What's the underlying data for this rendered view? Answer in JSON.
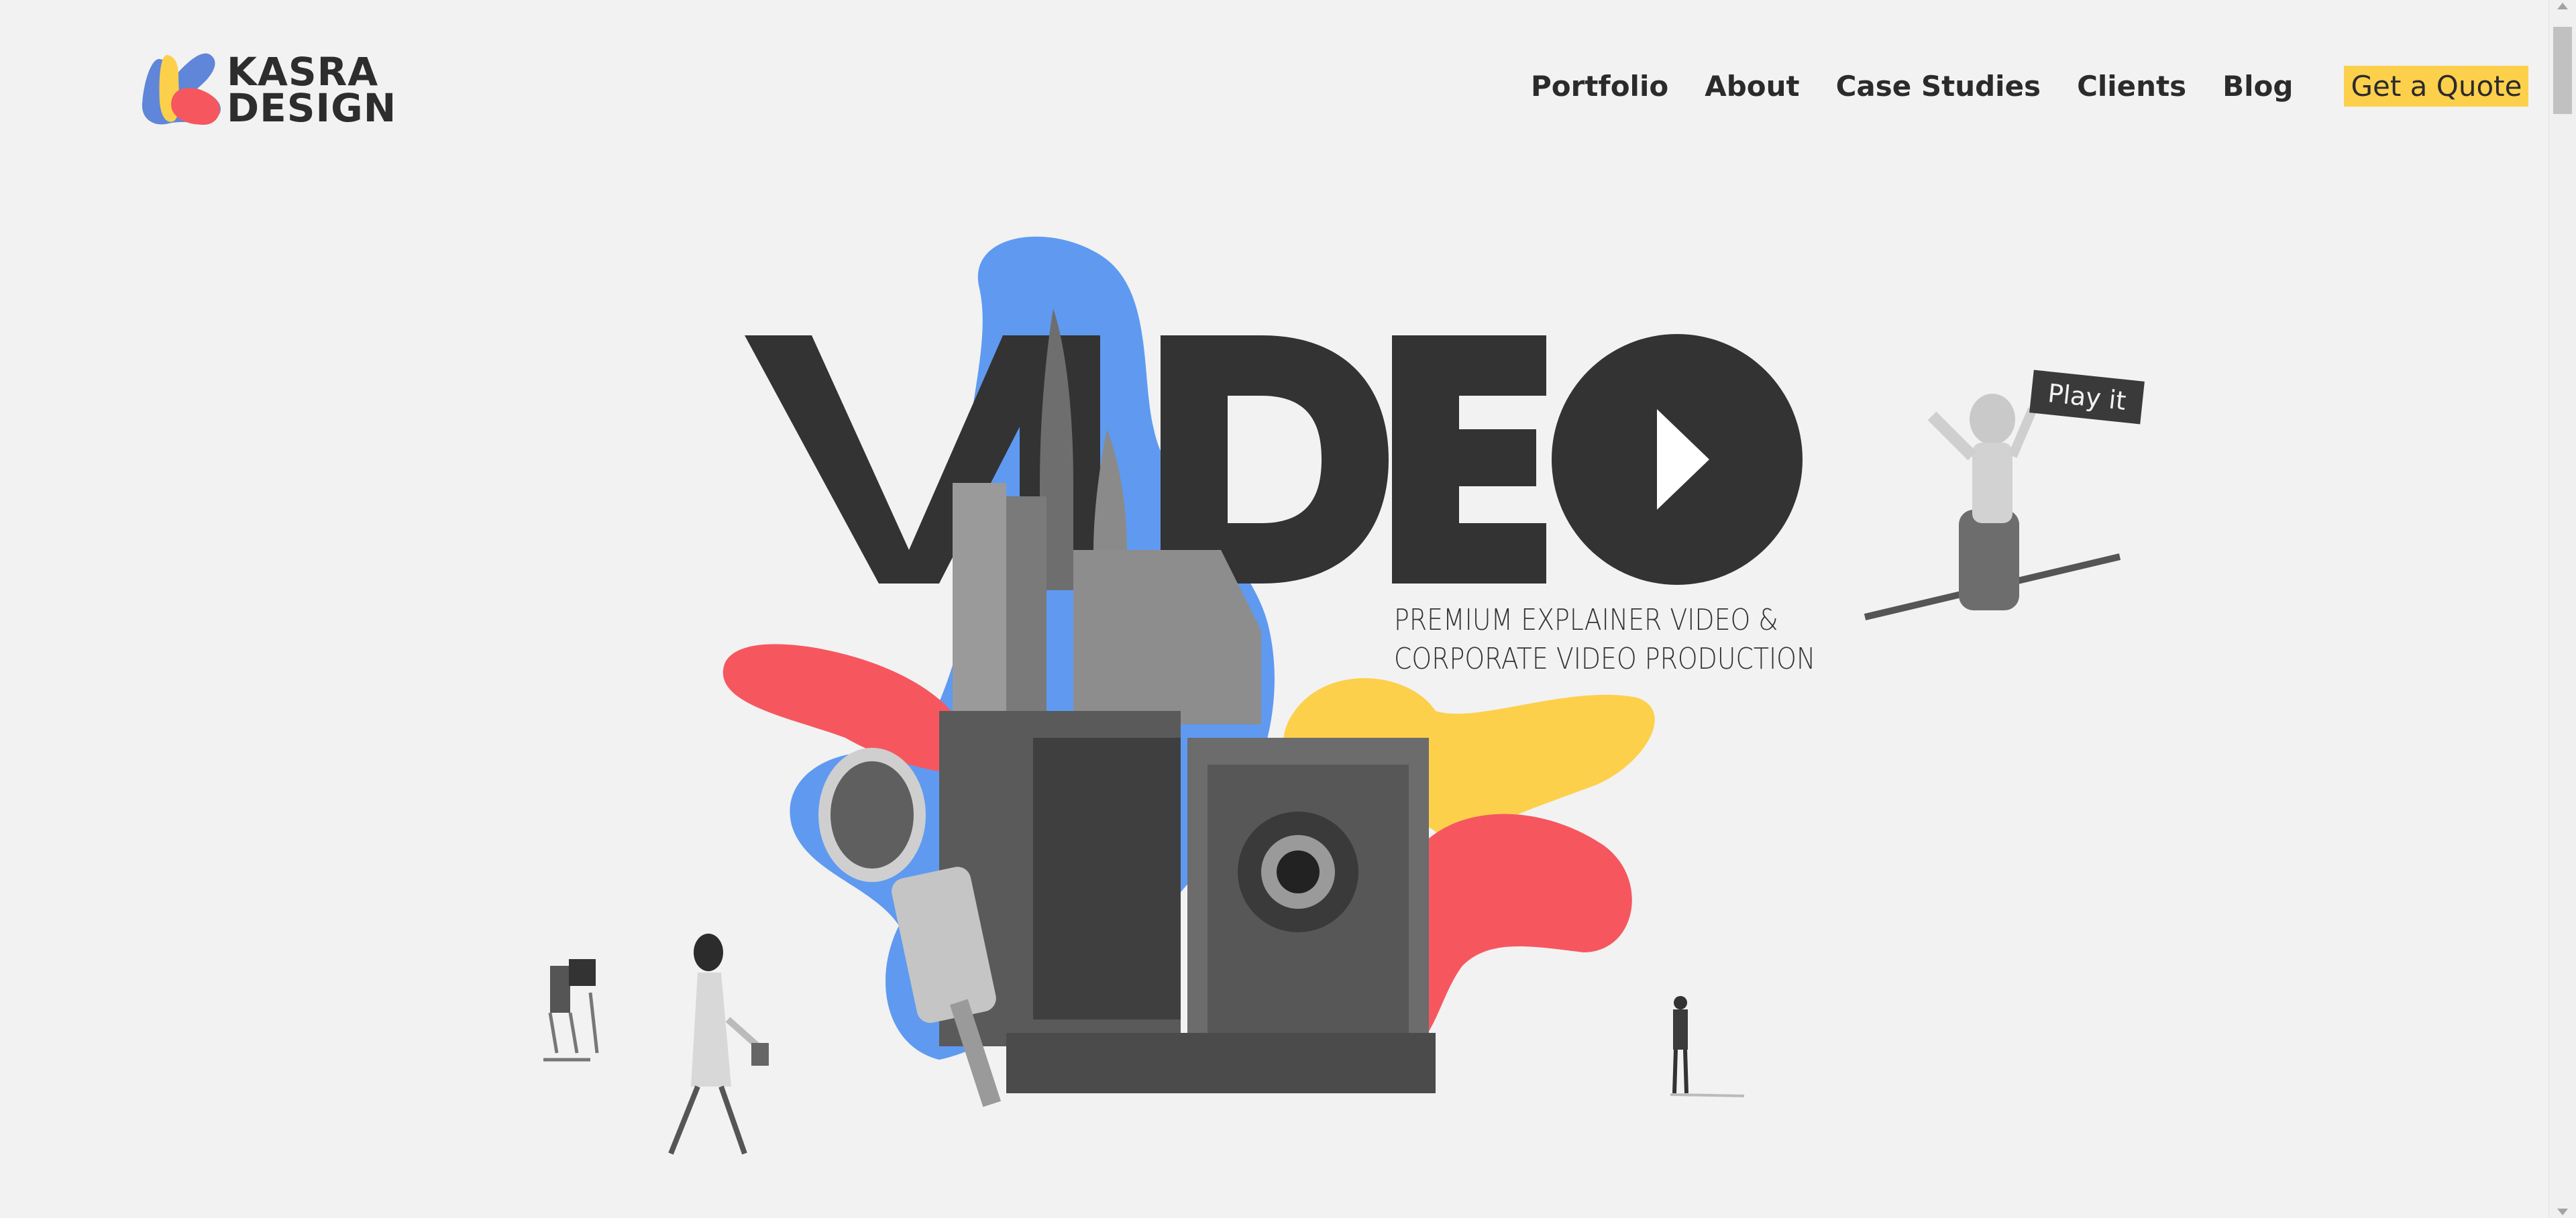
{
  "brand": {
    "line1": "KASRA",
    "line2": "DESIGN",
    "colors": {
      "blue": "#5f86d8",
      "yellow": "#fdd04c",
      "red": "#f6575f"
    }
  },
  "nav": {
    "items": [
      "Portfolio",
      "About",
      "Case Studies",
      "Clients",
      "Blog"
    ],
    "cta": "Get a Quote",
    "cta_color": "#fdd04c"
  },
  "hero": {
    "headline": "VIDEO",
    "subtitle_line1": "PREMIUM EXPLAINER VIDEO &",
    "subtitle_line2": "CORPORATE VIDEO PRODUCTION",
    "play_label": "Play it",
    "blob_colors": {
      "blue": "#5f9af0",
      "red": "#f6575f",
      "yellow": "#fdd04c"
    },
    "icons": [
      "play-icon",
      "astronaut-icon",
      "camera-icon",
      "rocket-icon",
      "microphone-icon"
    ]
  }
}
